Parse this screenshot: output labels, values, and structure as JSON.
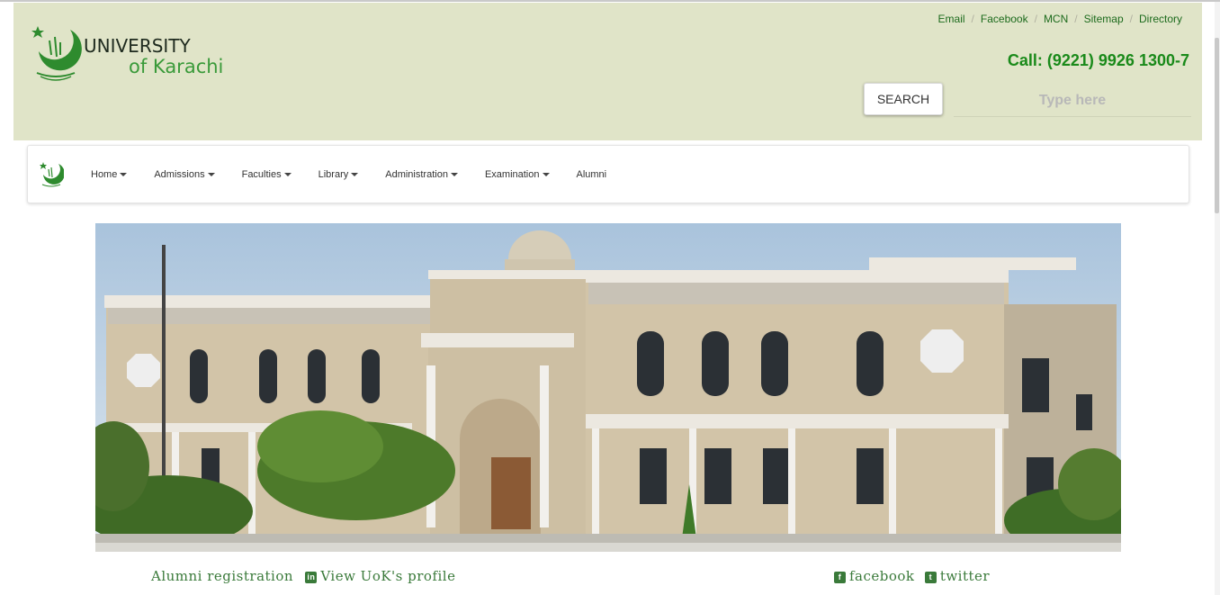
{
  "logo": {
    "line1": "UNIVERSITY",
    "line2": "of Karachi"
  },
  "toplinks": [
    "Email",
    "Facebook",
    "MCN",
    "Sitemap",
    "Directory"
  ],
  "phone": "Call: (9221) 9926 1300-7",
  "search": {
    "button_label": "SEARCH",
    "placeholder": "Type here"
  },
  "nav": {
    "items": [
      {
        "label": "Home",
        "dropdown": true
      },
      {
        "label": "Admissions",
        "dropdown": true
      },
      {
        "label": "Faculties",
        "dropdown": true
      },
      {
        "label": "Library",
        "dropdown": true
      },
      {
        "label": "Administration",
        "dropdown": true
      },
      {
        "label": "Examination",
        "dropdown": true
      },
      {
        "label": "Alumni",
        "dropdown": false
      }
    ]
  },
  "footer": {
    "alumni_registration": "Alumni registration",
    "linkedin_icon": "linkedin-icon",
    "view_profile": "View UoK's profile",
    "facebook_icon": "facebook-icon",
    "facebook": "facebook",
    "twitter_icon": "twitter-icon",
    "twitter": "twitter"
  },
  "colors": {
    "header_bg": "#e0e4c8",
    "brand_green": "#1a8a1a",
    "link_green": "#1d6b1d"
  }
}
